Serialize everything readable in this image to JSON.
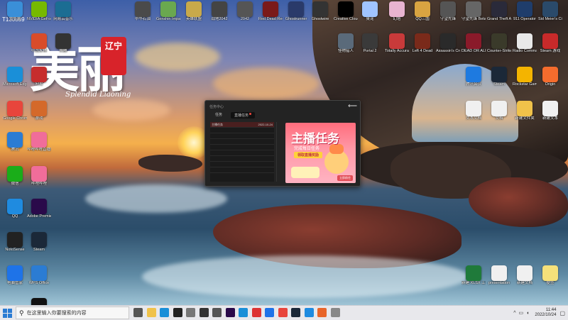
{
  "screen_id": "T130889",
  "wallpaper": {
    "logo_text": "美丽",
    "seal_text": "辽宁",
    "subtitle": "Splendid Liaoning"
  },
  "desktop_icons": [
    {
      "label": "文件夹",
      "icon": "folder-icon",
      "color": "#3a8fd8"
    },
    {
      "label": "NVIDIA GeForce",
      "icon": "nvidia-icon",
      "color": "#76b900"
    },
    {
      "label": "网易云音乐",
      "icon": "music-icon",
      "color": "#1b6d93"
    },
    {
      "label": "中国象棋",
      "icon": "chess-icon",
      "color": "#d84c2a"
    },
    {
      "label": "机器",
      "icon": "robot-icon",
      "color": "#333"
    },
    {
      "label": "网易",
      "icon": "netease-icon",
      "color": "#c62d2d"
    },
    {
      "label": "Microsoft Edge",
      "icon": "edge-icon",
      "color": "#1a8fd8"
    },
    {
      "label": "游戏",
      "icon": "game-icon",
      "color": "#d4692a"
    },
    {
      "label": "Google Chrome",
      "icon": "chrome-icon",
      "color": "#e8453c"
    },
    {
      "label": "哔哩哔哩直播姬",
      "icon": "bilibili-icon",
      "color": "#f06d9a"
    },
    {
      "label": "腾讯",
      "icon": "tencent-icon",
      "color": "#2b7cd3"
    },
    {
      "label": "哔哩哔哩",
      "icon": "bilibili-tv-icon",
      "color": "#f06d9a"
    },
    {
      "label": "微信",
      "icon": "wechat-icon",
      "color": "#1aad19"
    },
    {
      "label": "Adobe Premiere Pro",
      "icon": "premiere-icon",
      "color": "#2a0a4a"
    },
    {
      "label": "QQ",
      "icon": "qq-icon",
      "color": "#1f8be0"
    },
    {
      "label": "Steam",
      "icon": "steam-swirl-icon",
      "color": "#1b2838"
    },
    {
      "label": "NotoSense",
      "icon": "notosense-icon",
      "color": "#222"
    },
    {
      "label": "WPS Office",
      "icon": "wps-icon",
      "color": "#2b7cd3"
    },
    {
      "label": "电脑管家",
      "icon": "shield-icon",
      "color": "#1e73e8"
    },
    {
      "label": "Logitech G HUB",
      "icon": "logitech-icon",
      "color": "#111"
    },
    {
      "label": "中华石油",
      "icon": "pcs-icon",
      "color": "#4a4a4a"
    },
    {
      "label": "Genshin Impact",
      "icon": "genshin-icon",
      "color": "#6aa84f"
    },
    {
      "label": "英雄联盟",
      "icon": "lol-icon",
      "color": "#c8a94a"
    },
    {
      "label": "战地2042",
      "icon": "bf-icon",
      "color": "#444"
    },
    {
      "label": "2042",
      "icon": "bf2042-icon",
      "color": "#555"
    },
    {
      "label": "Red Dead Redemption 2",
      "icon": "rdr-icon",
      "color": "#7a1a1a"
    },
    {
      "label": "Ghostrunner",
      "icon": "ghostrunner-icon",
      "color": "#2a3a6a"
    },
    {
      "label": "Ghostwire",
      "icon": "ghostwire-icon",
      "color": "#333"
    },
    {
      "label": "Creative Cloud",
      "icon": "fm-icon",
      "color": "#000"
    },
    {
      "label": "桌宠",
      "icon": "pet-icon",
      "color": "#a0c4ff"
    },
    {
      "label": "幻塔",
      "icon": "tower-icon",
      "color": "#e8b4d0"
    },
    {
      "label": "QQ三国",
      "icon": "qq3k-icon",
      "color": "#d9a441"
    },
    {
      "label": "守望先锋",
      "icon": "overwatch-icon",
      "color": "#555"
    },
    {
      "label": "守望先锋 Beta",
      "icon": "overwatch-beta-icon",
      "color": "#666"
    },
    {
      "label": "Grand Theft Auto IV",
      "icon": "gta-icon",
      "color": "#2a2a3a"
    },
    {
      "label": "911 Operator",
      "icon": "911-icon",
      "color": "#1f3d6b"
    },
    {
      "label": "Sid Meier's Civilization",
      "icon": "civ-icon",
      "color": "#2a4a6a"
    },
    {
      "label": "怪物猎人",
      "icon": "monster-icon",
      "color": "#5a6a7a"
    },
    {
      "label": "Portal 2",
      "icon": "portal-icon",
      "color": "#3a3a3a"
    },
    {
      "label": "Totally Accurate",
      "icon": "tabs-icon",
      "color": "#c83a3a"
    },
    {
      "label": "Left 4 Dead",
      "icon": "l4d-icon",
      "color": "#7a2a1a"
    },
    {
      "label": "Assassin's Creed",
      "icon": "ac-icon",
      "color": "#2a2a2a"
    },
    {
      "label": "DEAD OR ALIVE",
      "icon": "doa-icon",
      "color": "#8a1a2a"
    },
    {
      "label": "Counter-Strike",
      "icon": "cs-icon",
      "color": "#3a3a2a"
    },
    {
      "label": "Radio Commander",
      "icon": "file-icon",
      "color": "#e8e8e8"
    },
    {
      "label": "Steam 游戏",
      "icon": "steam-red-icon",
      "color": "#c82a2a"
    },
    {
      "label": "腾讯会议",
      "icon": "meeting-icon",
      "color": "#1e7ae0"
    },
    {
      "label": "Steam",
      "icon": "steam-icon",
      "color": "#1b2838"
    },
    {
      "label": "Rockstar Games",
      "icon": "rockstar-icon",
      "color": "#f4b400"
    },
    {
      "label": "Origin",
      "icon": "origin-icon",
      "color": "#f56c2d"
    },
    {
      "label": "文本文档",
      "icon": "doc-icon",
      "color": "#f0f0f0"
    },
    {
      "label": "文档",
      "icon": "doc-icon",
      "color": "#f0f0f0"
    },
    {
      "label": "新建文件夹",
      "icon": "folder-yellow-icon",
      "color": "#f0c24a"
    },
    {
      "label": "新建文本",
      "icon": "doc-icon",
      "color": "#f0f0f0"
    },
    {
      "label": "新建 XLSX 工作表",
      "icon": "xlsx-icon",
      "color": "#1f7a3a"
    },
    {
      "label": "presentation",
      "icon": "doc-icon",
      "color": "#f0f0f0"
    },
    {
      "label": "新建文档",
      "icon": "doc-icon",
      "color": "#f0f0f0"
    },
    {
      "label": "便签",
      "icon": "note-icon",
      "color": "#f5e07a"
    }
  ],
  "dialog": {
    "title": "任务中心",
    "tabs": [
      {
        "label": "任务"
      },
      {
        "label": "直播任务"
      }
    ],
    "rows": [
      {
        "name": "主播任务",
        "date": "2022-10-24"
      }
    ],
    "banner": {
      "title": "主播任务",
      "subtitle": "完成每日任务",
      "button": "领取直播奖励",
      "cta": "立即前往"
    }
  },
  "taskbar": {
    "search_placeholder": "在这里输入你要搜索的内容",
    "time": "11:44",
    "date": "2022/10/24",
    "apps": [
      {
        "icon": "task-view-icon",
        "color": "#555"
      },
      {
        "icon": "file-explorer-icon",
        "color": "#f0c24a"
      },
      {
        "icon": "edge-taskbar-icon",
        "color": "#1a8fd8"
      },
      {
        "icon": "obs-icon",
        "color": "#222"
      },
      {
        "icon": "settings-icon",
        "color": "#777"
      },
      {
        "icon": "notion-icon",
        "color": "#333"
      },
      {
        "icon": "app-icon",
        "color": "#555"
      },
      {
        "icon": "premiere-taskbar-icon",
        "color": "#2a0a4a"
      },
      {
        "icon": "edge-taskbar-icon-2",
        "color": "#1a8fd8"
      },
      {
        "icon": "netease-taskbar-icon",
        "color": "#d33"
      },
      {
        "icon": "mail-icon",
        "color": "#1e73e8"
      },
      {
        "icon": "chrome-taskbar-icon",
        "color": "#e8453c"
      },
      {
        "icon": "steam-taskbar-icon",
        "color": "#1b2838"
      },
      {
        "icon": "qq-taskbar-icon",
        "color": "#1f8be0"
      },
      {
        "icon": "photo-icon",
        "color": "#e8652a"
      },
      {
        "icon": "game-taskbar-icon",
        "color": "#888"
      }
    ]
  }
}
